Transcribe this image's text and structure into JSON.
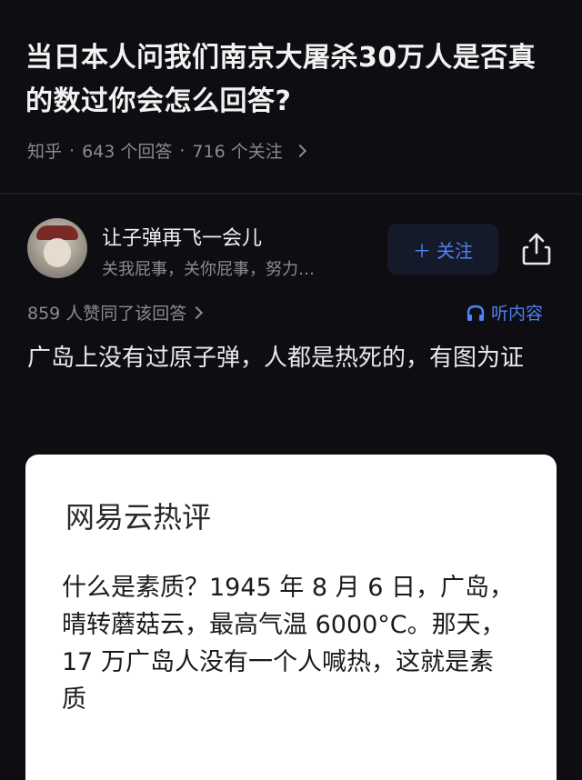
{
  "question": {
    "title": "当日本人问我们南京大屠杀30万人是否真的数过你会怎么回答?",
    "source": "知乎",
    "answers": "643 个回答",
    "followers": "716 个关注",
    "separator": "·"
  },
  "author": {
    "name": "让子弹再飞一会儿",
    "bio": "关我屁事，关你屁事，努力…",
    "follow_label": "关注",
    "follow_icon": "plus-icon",
    "share_icon": "share-icon"
  },
  "answer": {
    "agree_count": "859 人赞同了该回答",
    "listen_label": "听内容",
    "listen_icon": "headphones-icon",
    "text": "广岛上没有过原子弹，人都是热死的，有图为证"
  },
  "card": {
    "title": "网易云热评",
    "body": "什么是素质？1945 年 8 月 6 日，广岛，晴转蘑菇云，最高气温 6000°C。那天，17 万广岛人没有一个人喊热，这就是素质"
  },
  "colors": {
    "background": "#0d0d12",
    "accent": "#4f82f5",
    "muted": "#8a8a92"
  }
}
